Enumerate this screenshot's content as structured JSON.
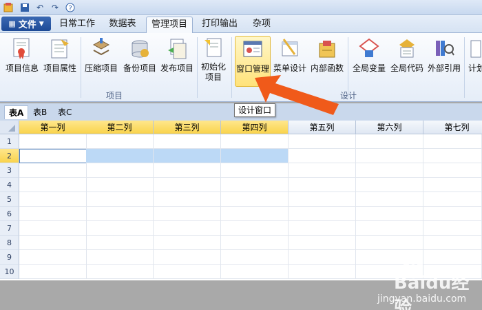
{
  "menu": {
    "file_label": "文件",
    "tabs": [
      {
        "label": "日常工作"
      },
      {
        "label": "数据表"
      },
      {
        "label": "管理项目"
      },
      {
        "label": "打印输出"
      },
      {
        "label": "杂项"
      }
    ],
    "active_tab": "管理项目"
  },
  "ribbon": {
    "buttons": [
      {
        "label": "项目信息",
        "icon": "ribbon-certificate-icon"
      },
      {
        "label": "项目属性",
        "icon": "ribbon-properties-icon"
      },
      {
        "label": "压缩项目",
        "icon": "ribbon-compress-icon"
      },
      {
        "label": "备份项目",
        "icon": "ribbon-backup-icon"
      },
      {
        "label": "发布项目",
        "icon": "ribbon-publish-icon"
      },
      {
        "label": "初始化\n项目",
        "icon": "ribbon-init-icon"
      },
      {
        "label": "窗口管理",
        "icon": "ribbon-window-icon"
      },
      {
        "label": "菜单设计",
        "icon": "ribbon-menu-design-icon"
      },
      {
        "label": "内部函数",
        "icon": "ribbon-function-icon"
      },
      {
        "label": "全局变量",
        "icon": "ribbon-global-var-icon"
      },
      {
        "label": "全局代码",
        "icon": "ribbon-global-code-icon"
      },
      {
        "label": "外部引用",
        "icon": "ribbon-reference-icon"
      },
      {
        "label": "计划",
        "icon": "ribbon-plan-icon"
      }
    ],
    "groups": [
      {
        "label": "项目"
      },
      {
        "label": "设计"
      }
    ]
  },
  "tooltip": "设计窗口",
  "sheets": [
    "表A",
    "表B",
    "表C"
  ],
  "active_sheet": "表A",
  "grid": {
    "columns": [
      "第一列",
      "第二列",
      "第三列",
      "第四列",
      "第五列",
      "第六列",
      "第七列"
    ],
    "rows": [
      "1",
      "2",
      "3",
      "4",
      "5",
      "6",
      "7",
      "8",
      "9",
      "10"
    ],
    "selected_row": "2"
  },
  "watermark": {
    "brand": "Baidu经验",
    "url": "jingyan.baidu.com"
  },
  "colors": {
    "accent": "#1d4a96",
    "highlight": "#ffe27a",
    "selection": "#bcd9f6",
    "arrow": "#f05a1a"
  }
}
